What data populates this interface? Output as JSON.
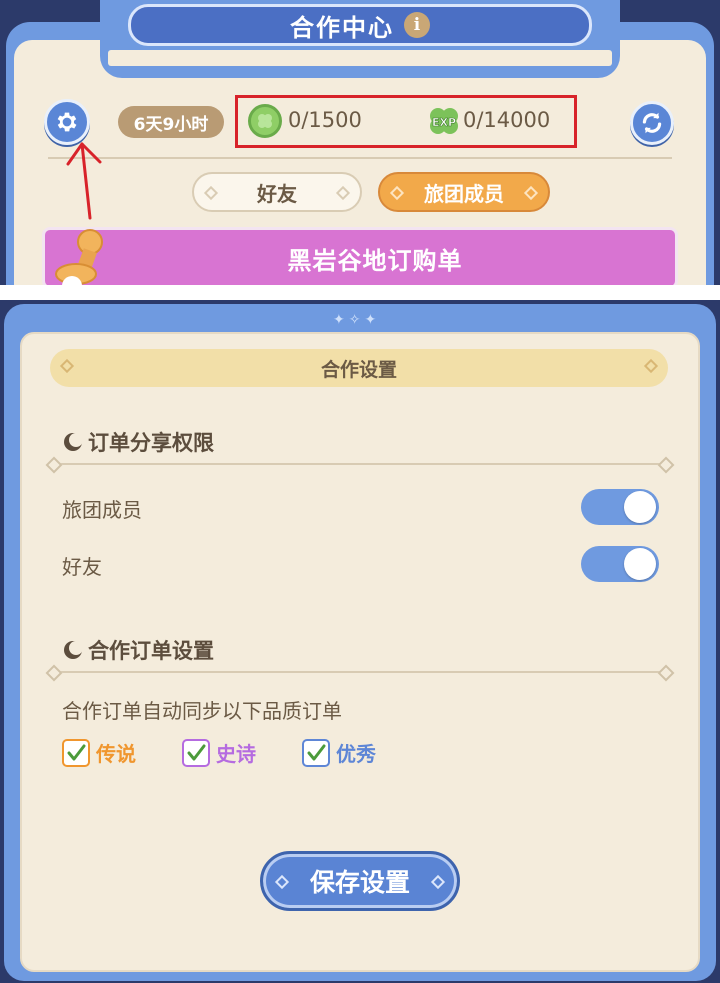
{
  "top": {
    "title": "合作中心",
    "info_icon_glyph": "i",
    "timer": "6天9小时",
    "coin": "0/1500",
    "exp_icon_text": "EXP",
    "exp": "0/14000",
    "tabs": {
      "friends": "好友",
      "members": "旅团成员"
    },
    "order_title": "黑岩谷地订购单",
    "highlight_color": "#d8232a"
  },
  "settings": {
    "title": "合作设置",
    "share_section": "订单分享权限",
    "share_rows": [
      {
        "label": "旅团成员",
        "enabled": true
      },
      {
        "label": "好友",
        "enabled": true
      }
    ],
    "coop_section": "合作订单设置",
    "sync_text": "合作订单自动同步以下品质订单",
    "qualities": [
      {
        "label": "传说",
        "checked": true,
        "color": "#f0962e"
      },
      {
        "label": "史诗",
        "checked": true,
        "color": "#b56be0"
      },
      {
        "label": "优秀",
        "checked": true,
        "color": "#5e86d6"
      }
    ],
    "save_label": "保存设置"
  },
  "colors": {
    "frame_blue": "#6f9ae0",
    "panel_cream": "#f4ecdc",
    "toggle_on": "#6f9ae0",
    "order_banner": "#d874d2",
    "active_tab": "#f2a94a"
  }
}
